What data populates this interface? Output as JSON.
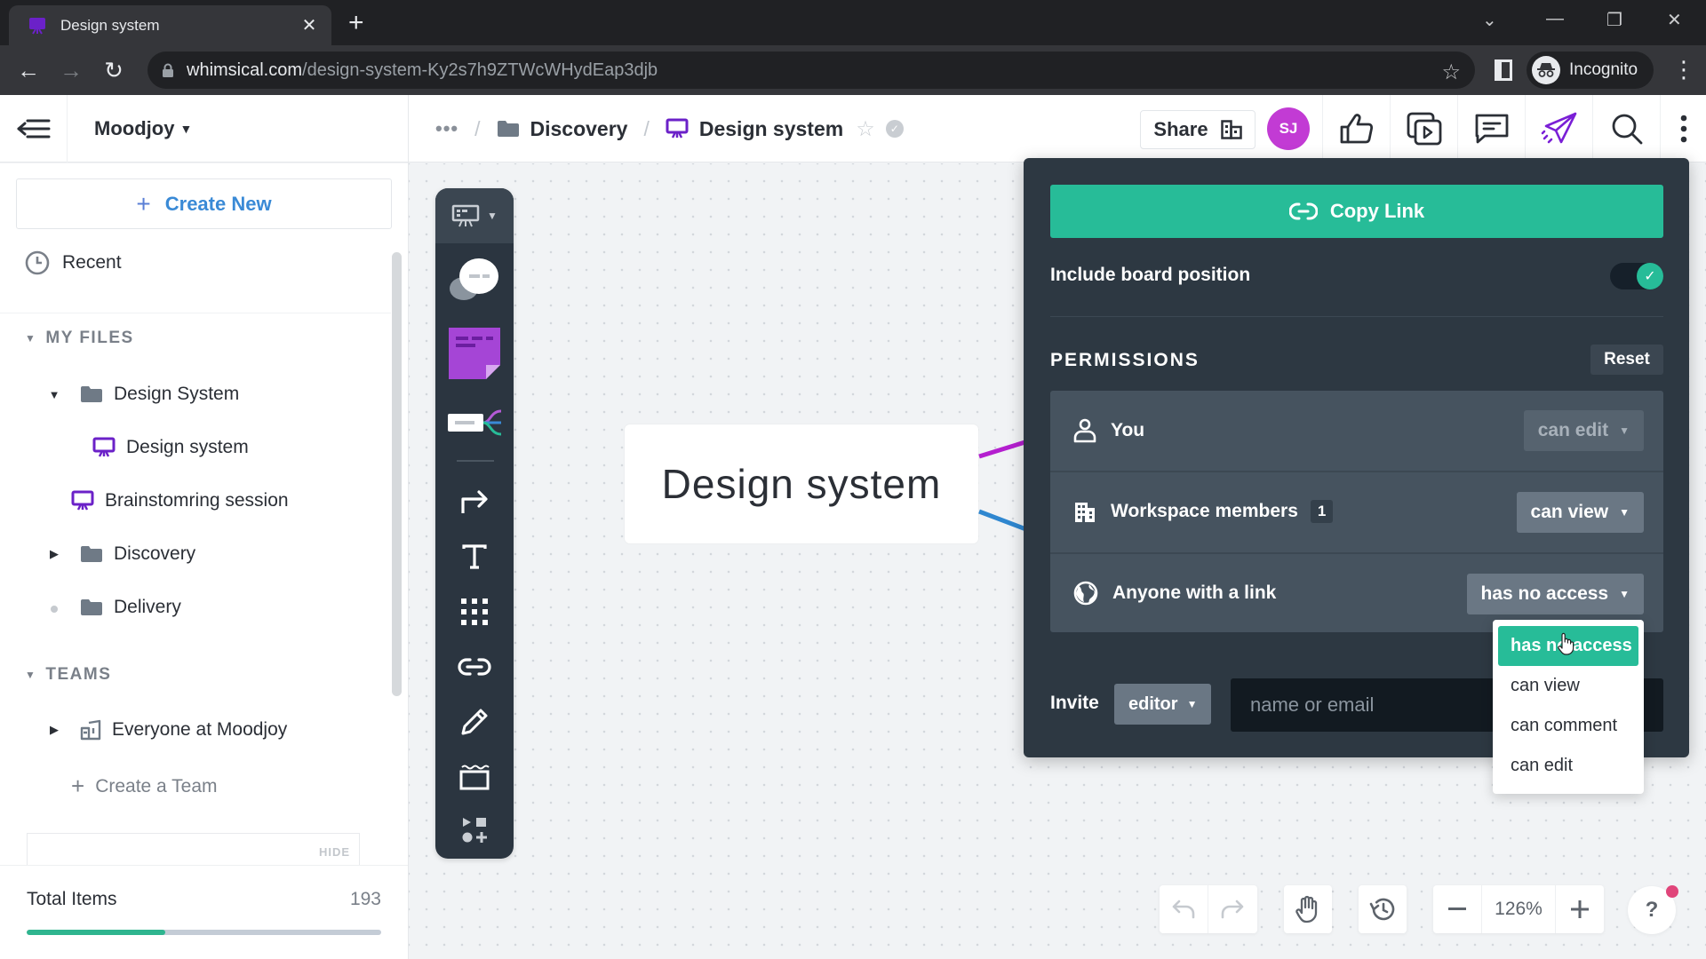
{
  "browser": {
    "tab_title": "Design system",
    "url_host": "whimsical.com",
    "url_path": "/design-system-Ky2s7h9ZTWcWHydEap3djb",
    "profile_label": "Incognito"
  },
  "header": {
    "workspace": "Moodjoy",
    "breadcrumb": {
      "ellipsis": "•••",
      "folder": "Discovery",
      "board": "Design system",
      "separator": "/"
    },
    "share_label": "Share",
    "avatar_initials": "SJ",
    "accent_color": "#c23bd4"
  },
  "sidebar": {
    "create_new": "Create New",
    "recent": "Recent",
    "my_files_label": "MY FILES",
    "files": [
      {
        "label": "Design System",
        "type": "folder",
        "state": "expanded"
      },
      {
        "label": "Design system",
        "type": "board"
      },
      {
        "label": "Brainstomring session",
        "type": "board"
      },
      {
        "label": "Discovery",
        "type": "folder",
        "state": "collapsed"
      },
      {
        "label": "Delivery",
        "type": "folder",
        "state": "empty"
      }
    ],
    "teams_label": "TEAMS",
    "teams": [
      {
        "label": "Everyone at Moodjoy"
      }
    ],
    "create_team": "Create a Team",
    "hide_label": "HIDE",
    "total_items_label": "Total Items",
    "total_items_value": "193",
    "usage_fraction": 0.39
  },
  "canvas": {
    "node_label": "Design system",
    "zoom_level": "126%",
    "palette_tools": [
      "board-tool",
      "comment-shape-tool",
      "sticky-note-tool",
      "mindmap-tool",
      "connector-tool",
      "text-tool",
      "grid-tool",
      "link-tool",
      "pencil-tool",
      "section-tool",
      "more-shapes-tool"
    ]
  },
  "share_panel": {
    "copy_link": "Copy Link",
    "include_board_position": "Include board position",
    "include_board_position_on": true,
    "permissions_title": "PERMISSIONS",
    "reset_label": "Reset",
    "rows": [
      {
        "label": "You",
        "value": "can edit",
        "disabled": true
      },
      {
        "label": "Workspace members",
        "badge": "1",
        "value": "can view"
      },
      {
        "label": "Anyone with a link",
        "value": "has no access"
      }
    ],
    "invite_label": "Invite",
    "invite_role": "editor",
    "invite_placeholder": "name or email",
    "dropdown_options": [
      "has no access",
      "can view",
      "can comment",
      "can edit"
    ],
    "dropdown_selected": "has no access",
    "accent_color": "#27bc98"
  }
}
